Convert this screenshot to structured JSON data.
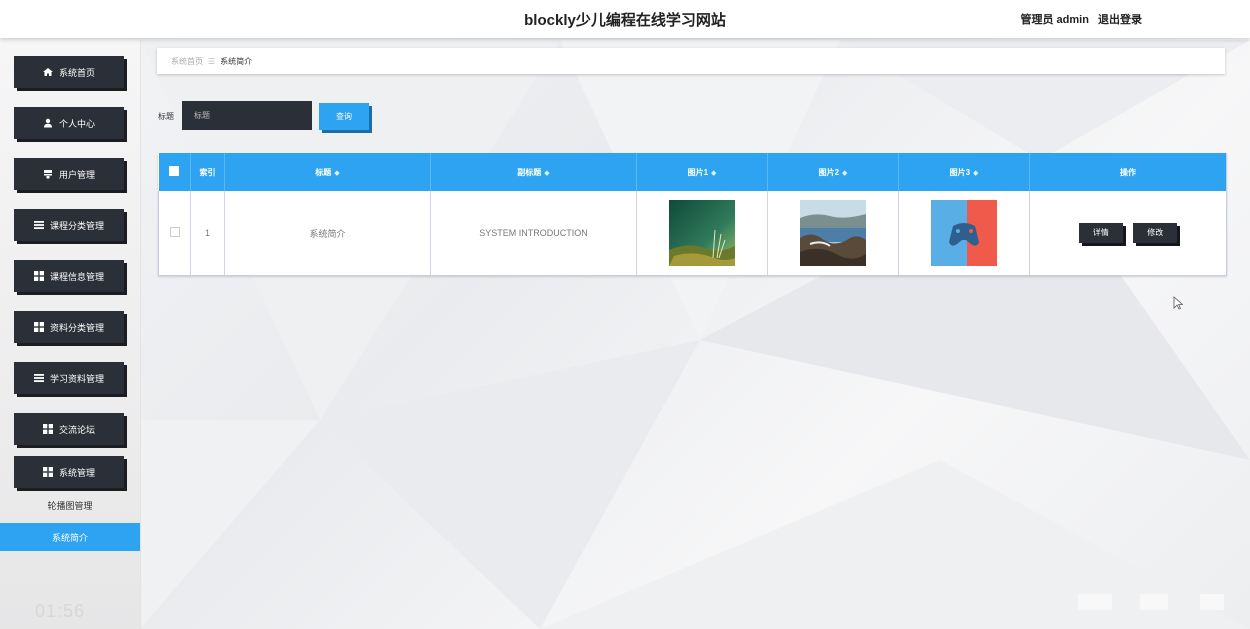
{
  "header": {
    "site_title": "blockly少儿编程在线学习网站",
    "user_role": "管理员 admin",
    "logout_label": "退出登录"
  },
  "sidebar": {
    "items": [
      {
        "label": "系统首页",
        "icon": "home-icon"
      },
      {
        "label": "个人中心",
        "icon": "user-icon"
      },
      {
        "label": "用户管理",
        "icon": "users-icon"
      },
      {
        "label": "课程分类管理",
        "icon": "list-icon"
      },
      {
        "label": "课程信息管理",
        "icon": "grid-icon"
      },
      {
        "label": "资料分类管理",
        "icon": "grid-icon"
      },
      {
        "label": "学习资料管理",
        "icon": "list-icon"
      },
      {
        "label": "交流论坛",
        "icon": "grid-icon"
      },
      {
        "label": "系统管理",
        "icon": "grid-icon"
      }
    ],
    "subitems": [
      {
        "label": "轮播图管理",
        "active": false
      },
      {
        "label": "系统简介",
        "active": true
      }
    ],
    "timer": "01:56"
  },
  "breadcrumb": {
    "home": "系统首页",
    "separator": "☰",
    "current": "系统简介"
  },
  "search": {
    "label": "标题",
    "placeholder": "标题",
    "button_label": "查询"
  },
  "table": {
    "columns": [
      "索引",
      "标题",
      "副标题",
      "图片1",
      "图片2",
      "图片3",
      "操作"
    ],
    "sort_icon": "◆",
    "rows": [
      {
        "index": "1",
        "title": "系统简介",
        "subtitle": "SYSTEM INTRODUCTION",
        "image1": "moss-plant-photo",
        "image2": "coastal-rocks-photo",
        "image3": "gamepad-illustration",
        "actions": [
          "详情",
          "修改"
        ]
      }
    ]
  },
  "colors": {
    "accent": "#2ea3f2",
    "dark": "#2b2f38",
    "header_bg": "#ffffff"
  }
}
